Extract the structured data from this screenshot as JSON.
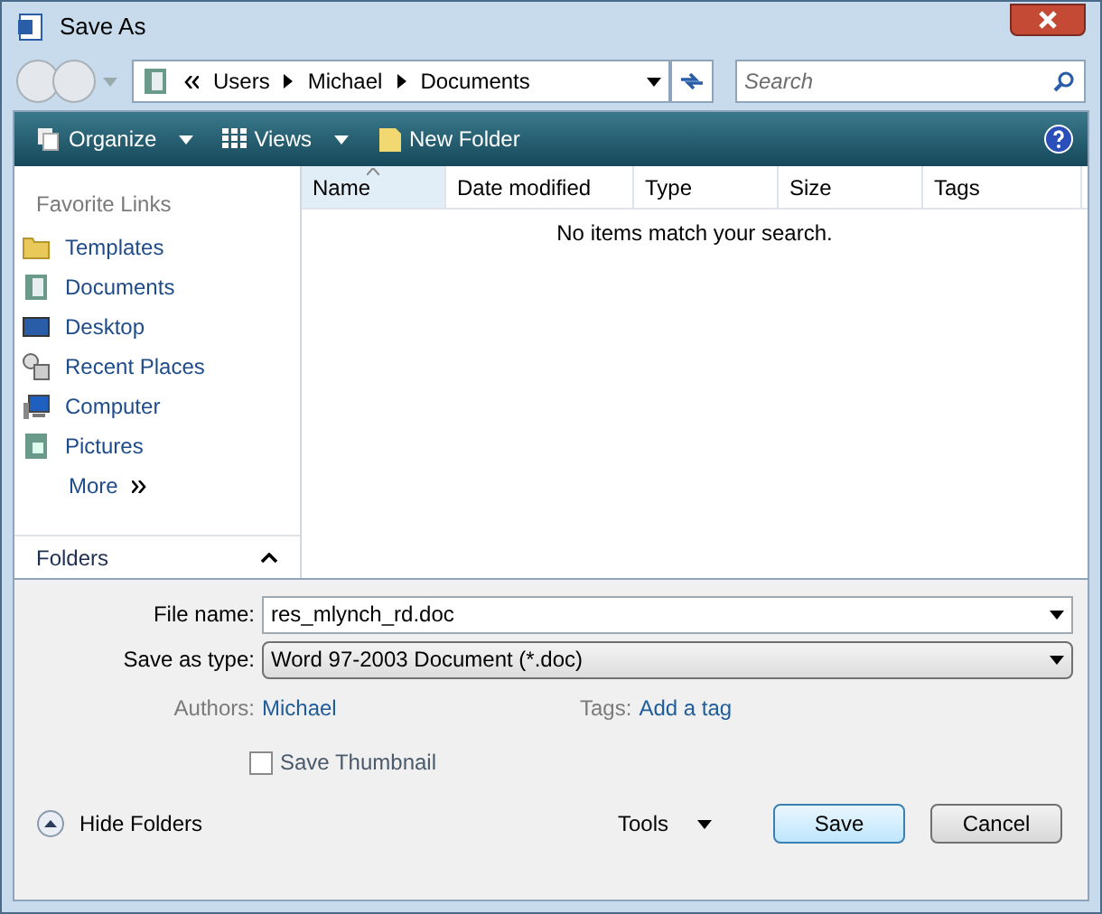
{
  "window": {
    "title": "Save As"
  },
  "address": {
    "segments": [
      "Users",
      "Michael",
      "Documents"
    ]
  },
  "search": {
    "placeholder": "Search"
  },
  "toolbar": [
    "Organize",
    "Views",
    "New Folder"
  ],
  "sidebar": {
    "heading": "Favorite Links",
    "items": [
      {
        "label": "Templates",
        "kind": "folder"
      },
      {
        "label": "Documents",
        "kind": "documents"
      },
      {
        "label": "Desktop",
        "kind": "desktop"
      },
      {
        "label": "Recent Places",
        "kind": "recent"
      },
      {
        "label": "Computer",
        "kind": "computer"
      },
      {
        "label": "Pictures",
        "kind": "pictures"
      }
    ],
    "more": "More",
    "folders": "Folders"
  },
  "table": {
    "columns": [
      {
        "label": "Name",
        "sorted": true
      },
      {
        "label": "Date modified",
        "sorted": false
      },
      {
        "label": "Type",
        "sorted": false
      },
      {
        "label": "Size",
        "sorted": false
      },
      {
        "label": "Tags",
        "sorted": false
      }
    ],
    "empty_message": "No items match your search."
  },
  "form": {
    "file_name_label": "File name:",
    "file_name": "res_mlynch_rd.doc",
    "type_label": "Save as type:",
    "type": "Word 97-2003 Document (*.doc)",
    "authors_label": "Authors:",
    "authors": "Michael",
    "tags_label": "Tags:",
    "tags": "Add a tag",
    "thumbnail_label": "Save Thumbnail",
    "thumbnail_checked": false
  },
  "footer": {
    "hide_folders": "Hide Folders",
    "tools": "Tools",
    "buttons": [
      "Save",
      "Cancel"
    ]
  }
}
